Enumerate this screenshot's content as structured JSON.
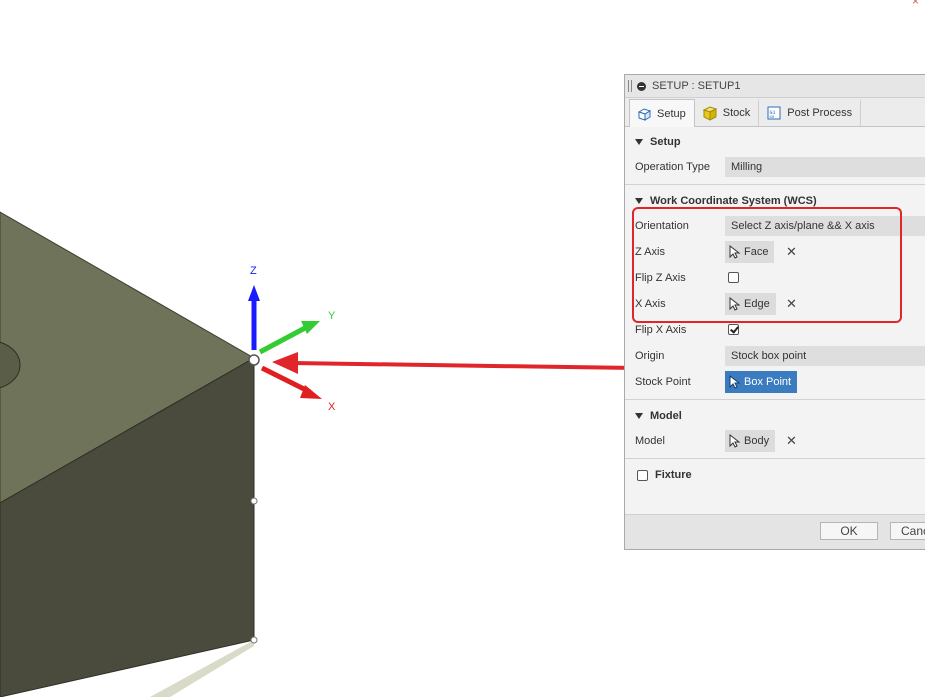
{
  "dialog": {
    "title": "SETUP : SETUP1",
    "tabs": [
      {
        "label": "Setup",
        "icon": "setup-cube-icon",
        "active": true
      },
      {
        "label": "Stock",
        "icon": "stock-box-icon",
        "active": false
      },
      {
        "label": "Post Process",
        "icon": "post-process-icon",
        "active": false
      }
    ],
    "setup_section": {
      "title": "Setup",
      "operation_type_label": "Operation Type",
      "operation_type_value": "Milling"
    },
    "wcs_section": {
      "title": "Work Coordinate System (WCS)",
      "orientation_label": "Orientation",
      "orientation_value": "Select Z axis/plane && X axis",
      "z_axis_label": "Z Axis",
      "z_axis_value": "Face",
      "flip_z_label": "Flip Z Axis",
      "flip_z_checked": false,
      "x_axis_label": "X Axis",
      "x_axis_value": "Edge",
      "flip_x_label": "Flip X Axis",
      "flip_x_checked": true,
      "origin_label": "Origin",
      "origin_value": "Stock box point",
      "stock_point_label": "Stock Point",
      "stock_point_value": "Box Point"
    },
    "model_section": {
      "title": "Model",
      "model_label": "Model",
      "model_value": "Body"
    },
    "fixture_section": {
      "title": "Fixture",
      "checked": false
    },
    "footer": {
      "ok_label": "OK",
      "cancel_label": "Cancel"
    }
  },
  "triad": {
    "z_label": "Z",
    "y_label": "Y",
    "x_label": "X",
    "colors": {
      "z": "#1a1aff",
      "y": "#33cc33",
      "x": "#e02020"
    }
  },
  "close_glyph": "×",
  "annotation": {
    "highlight_color": "#e0262b",
    "arrow_color": "#e0262b"
  }
}
